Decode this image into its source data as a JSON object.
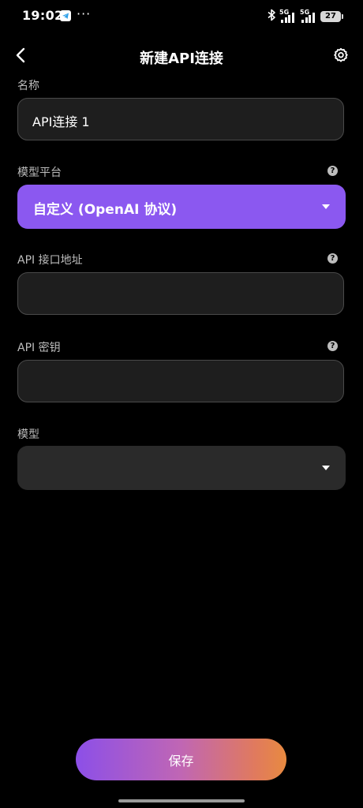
{
  "status_bar": {
    "time": "19:02",
    "dots": "···",
    "network_1": "5G",
    "network_2": "5G",
    "battery": "27"
  },
  "header": {
    "title": "新建API连接",
    "back_icon": "chevron-left-icon",
    "settings_icon": "gear-icon"
  },
  "form": {
    "name": {
      "label": "名称",
      "value": "API连接 1"
    },
    "platform": {
      "label": "模型平台",
      "value": "自定义 (OpenAI 协议)"
    },
    "endpoint": {
      "label": "API 接口地址",
      "value": ""
    },
    "api_key": {
      "label": "API 密钥",
      "value": ""
    },
    "model": {
      "label": "模型",
      "value": ""
    },
    "help_glyph": "?"
  },
  "actions": {
    "save_label": "保存"
  },
  "colors": {
    "background": "#000000",
    "accent_purple": "#8b58f0",
    "input_bg": "#1e1e1e",
    "gradient_start": "#8c4fe8",
    "gradient_end": "#e88a40"
  }
}
